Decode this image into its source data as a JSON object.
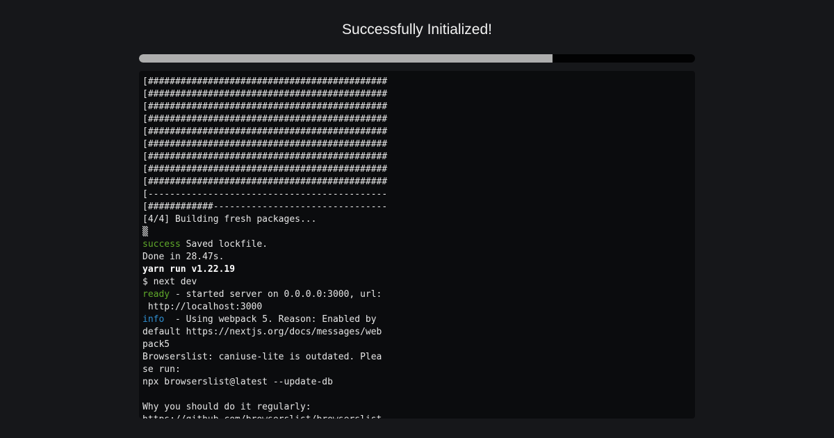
{
  "header": {
    "title": "Successfully Initialized!"
  },
  "progress": {
    "fraction": 0.744
  },
  "colors": {
    "background": "#16171a",
    "terminal_background": "#0b0c0e",
    "progress_fill": "#aeaeae",
    "progress_track": "#020203",
    "success_green": "#5fa82a",
    "info_blue": "#2f8fd1"
  },
  "terminal": {
    "lines": [
      [
        {
          "text": "[############################################",
          "style": "normal"
        }
      ],
      [
        {
          "text": "[############################################",
          "style": "normal"
        }
      ],
      [
        {
          "text": "[############################################",
          "style": "normal"
        }
      ],
      [
        {
          "text": "[############################################",
          "style": "normal"
        }
      ],
      [
        {
          "text": "[############################################",
          "style": "normal"
        }
      ],
      [
        {
          "text": "[############################################",
          "style": "normal"
        }
      ],
      [
        {
          "text": "[############################################",
          "style": "normal"
        }
      ],
      [
        {
          "text": "[############################################",
          "style": "normal"
        }
      ],
      [
        {
          "text": "[############################################",
          "style": "normal"
        }
      ],
      [
        {
          "text": "[--------------------------------------------",
          "style": "normal"
        }
      ],
      [
        {
          "text": "[############--------------------------------",
          "style": "normal"
        }
      ],
      [
        {
          "text": "[4/4] Building fresh packages...",
          "style": "normal"
        }
      ],
      [
        {
          "text": "▒",
          "style": "normal"
        }
      ],
      [
        {
          "text": "success",
          "style": "green"
        },
        {
          "text": " Saved lockfile.",
          "style": "normal"
        }
      ],
      [
        {
          "text": "Done in 28.47s.",
          "style": "normal"
        }
      ],
      [
        {
          "text": "yarn run v1.22.19",
          "style": "bold"
        }
      ],
      [
        {
          "text": "$ next dev",
          "style": "normal"
        }
      ],
      [
        {
          "text": "ready",
          "style": "green"
        },
        {
          "text": " - started server on 0.0.0.0:3000, url:",
          "style": "normal"
        }
      ],
      [
        {
          "text": " http://localhost:3000",
          "style": "normal"
        }
      ],
      [
        {
          "text": "info",
          "style": "blue"
        },
        {
          "text": "  - Using webpack 5. Reason: Enabled by",
          "style": "normal"
        }
      ],
      [
        {
          "text": "default https://nextjs.org/docs/messages/web",
          "style": "normal"
        }
      ],
      [
        {
          "text": "pack5",
          "style": "normal"
        }
      ],
      [
        {
          "text": "Browserslist: caniuse-lite is outdated. Plea",
          "style": "normal"
        }
      ],
      [
        {
          "text": "se run:",
          "style": "normal"
        }
      ],
      [
        {
          "text": "npx browserslist@latest --update-db",
          "style": "normal"
        }
      ],
      [
        {
          "text": "",
          "style": "normal"
        }
      ],
      [
        {
          "text": "Why you should do it regularly:",
          "style": "normal"
        }
      ],
      [
        {
          "text": "https://github.com/browserslist/browserslist",
          "style": "normal"
        }
      ]
    ]
  }
}
